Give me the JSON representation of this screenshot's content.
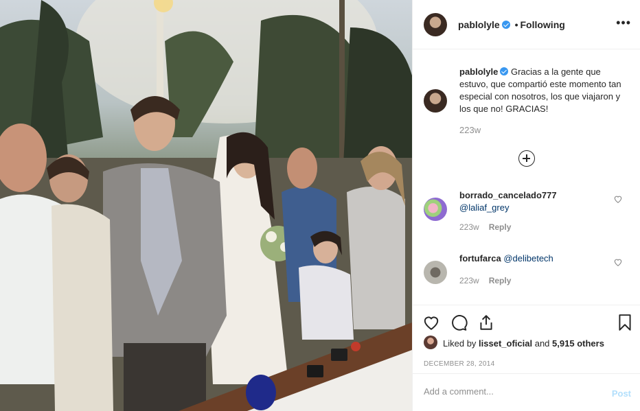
{
  "post": {
    "username": "pablolyle",
    "separator": "•",
    "follow_status": "Following",
    "more_icon": "more-horizontal-icon",
    "photo_icon": "wedding-ceremony-photo"
  },
  "caption": {
    "username": "pablolyle",
    "text": "Gracias a la gente que estuvo, que compartió este momento tan especial con nosotros, los que viajaron y los que no! GRACIAS!",
    "time": "223w"
  },
  "load_more_icon": "plus-circle-icon",
  "comments": [
    {
      "username": "borrado_cancelado777",
      "mention": "@laliaf_grey",
      "time": "223w",
      "reply": "Reply"
    },
    {
      "username": "fortufarca",
      "mention": "@delibetech",
      "time": "223w",
      "reply": "Reply"
    }
  ],
  "actions": {
    "like_icon": "heart-icon",
    "comment_icon": "comment-icon",
    "share_icon": "share-icon",
    "save_icon": "bookmark-icon",
    "liked_by_prefix": "Liked by",
    "liked_by_user": "lisset_oficial",
    "and": "and",
    "others": "5,915 others",
    "date": "December 28, 2014"
  },
  "add_comment": {
    "placeholder": "Add a comment...",
    "post_label": "Post"
  },
  "colors": {
    "verified": "#3897f0",
    "link": "#003569",
    "muted": "#8e8e8e",
    "post_disabled": "#b2dffc"
  }
}
